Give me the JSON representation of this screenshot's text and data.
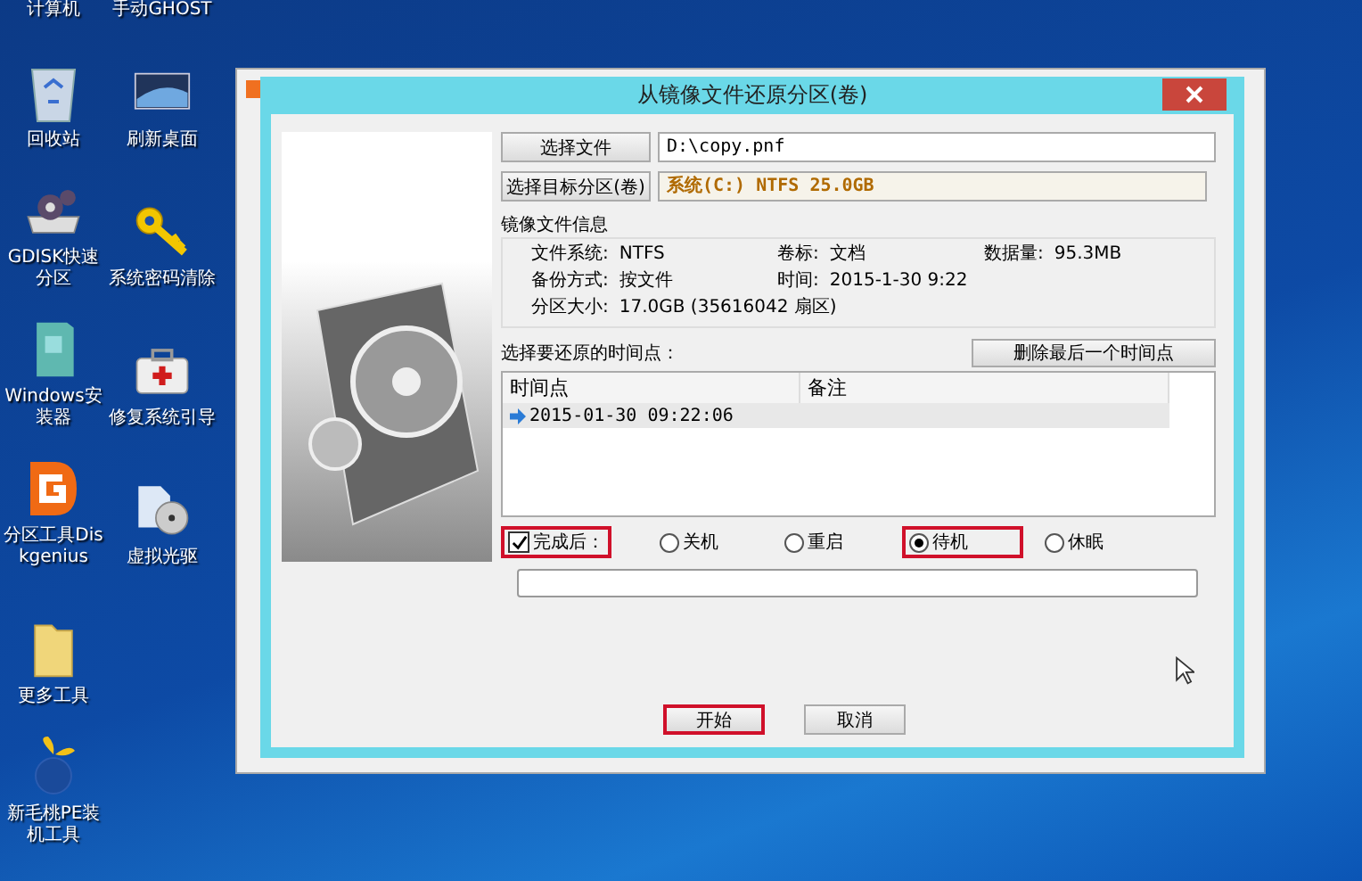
{
  "desktop_icons": [
    {
      "label": "计算机",
      "kind": "cut"
    },
    {
      "label": "手动GHOST",
      "kind": "cut"
    },
    {
      "label": "回收站",
      "kind": "recycle-bin"
    },
    {
      "label": "刷新桌面",
      "kind": "monitor"
    },
    {
      "label": "GDISK快速分区",
      "kind": "disk-gear"
    },
    {
      "label": "系统密码清除",
      "kind": "key"
    },
    {
      "label": "Windows安装器",
      "kind": "installer"
    },
    {
      "label": "修复系统引导",
      "kind": "toolbox"
    },
    {
      "label": "分区工具Diskgenius",
      "kind": "diskgenius"
    },
    {
      "label": "虚拟光驱",
      "kind": "disc"
    },
    {
      "label": "更多工具",
      "kind": "folder"
    },
    {
      "kind": "none"
    },
    {
      "label": "新毛桃PE装机工具",
      "kind": "peach"
    }
  ],
  "dialog": {
    "title": "从镜像文件还原分区(卷)",
    "file_button": "选择文件",
    "file_path": "D:\\copy.pnf",
    "target_button": "选择目标分区(卷)",
    "target_value": "系统(C:) NTFS 25.0GB",
    "info_title": "镜像文件信息",
    "info": [
      {
        "label": "文件系统:",
        "value": "NTFS"
      },
      {
        "label": "卷标:",
        "value": "文档"
      },
      {
        "label": "数据量:",
        "value": "95.3MB"
      },
      {
        "label": "备份方式:",
        "value": "按文件"
      },
      {
        "label": "时间:",
        "value": "2015-1-30 9:22"
      },
      {
        "label": "分区大小:",
        "value": "17.0GB   (35616042 扇区)"
      }
    ],
    "timepoint_label": "选择要还原的时间点：",
    "delete_button": "删除最后一个时间点",
    "columns": [
      "时间点",
      "备注"
    ],
    "rows": [
      {
        "time": "2015-01-30 09:22:06",
        "selected": true
      }
    ],
    "after": {
      "label": "完成后：",
      "checked": true,
      "highlighted": true
    },
    "options": [
      {
        "label": "关机",
        "selected": false,
        "highlighted": false
      },
      {
        "label": "重启",
        "selected": false,
        "highlighted": false
      },
      {
        "label": "待机",
        "selected": true,
        "highlighted": true
      },
      {
        "label": "休眠",
        "selected": false,
        "highlighted": false
      }
    ],
    "progress": {
      "level": 0
    },
    "buttons": [
      {
        "label": "开始",
        "highlighted": true
      },
      {
        "label": "取消",
        "highlighted": false
      }
    ]
  }
}
